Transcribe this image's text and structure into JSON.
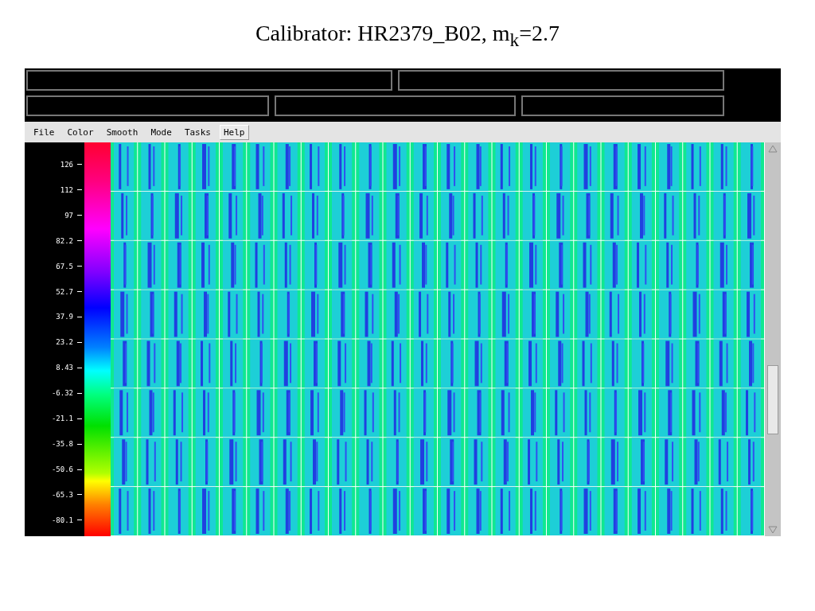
{
  "slide_title": "Calibrator: HR2379_B02, m$_{k}$=2.7",
  "menu": [
    {
      "label": "File",
      "selected": false
    },
    {
      "label": "Color",
      "selected": false
    },
    {
      "label": "Smooth",
      "selected": false
    },
    {
      "label": "Mode",
      "selected": false
    },
    {
      "label": "Tasks",
      "selected": false
    },
    {
      "label": "Help",
      "selected": true
    }
  ],
  "colorbar_labels": [
    "126",
    "112",
    "97",
    "82.2",
    "67.5",
    "52.7",
    "37.9",
    "23.2",
    "8.43",
    "-6.32",
    "-21.1",
    "-35.8",
    "-50.6",
    "-65.3",
    "-80.1"
  ]
}
